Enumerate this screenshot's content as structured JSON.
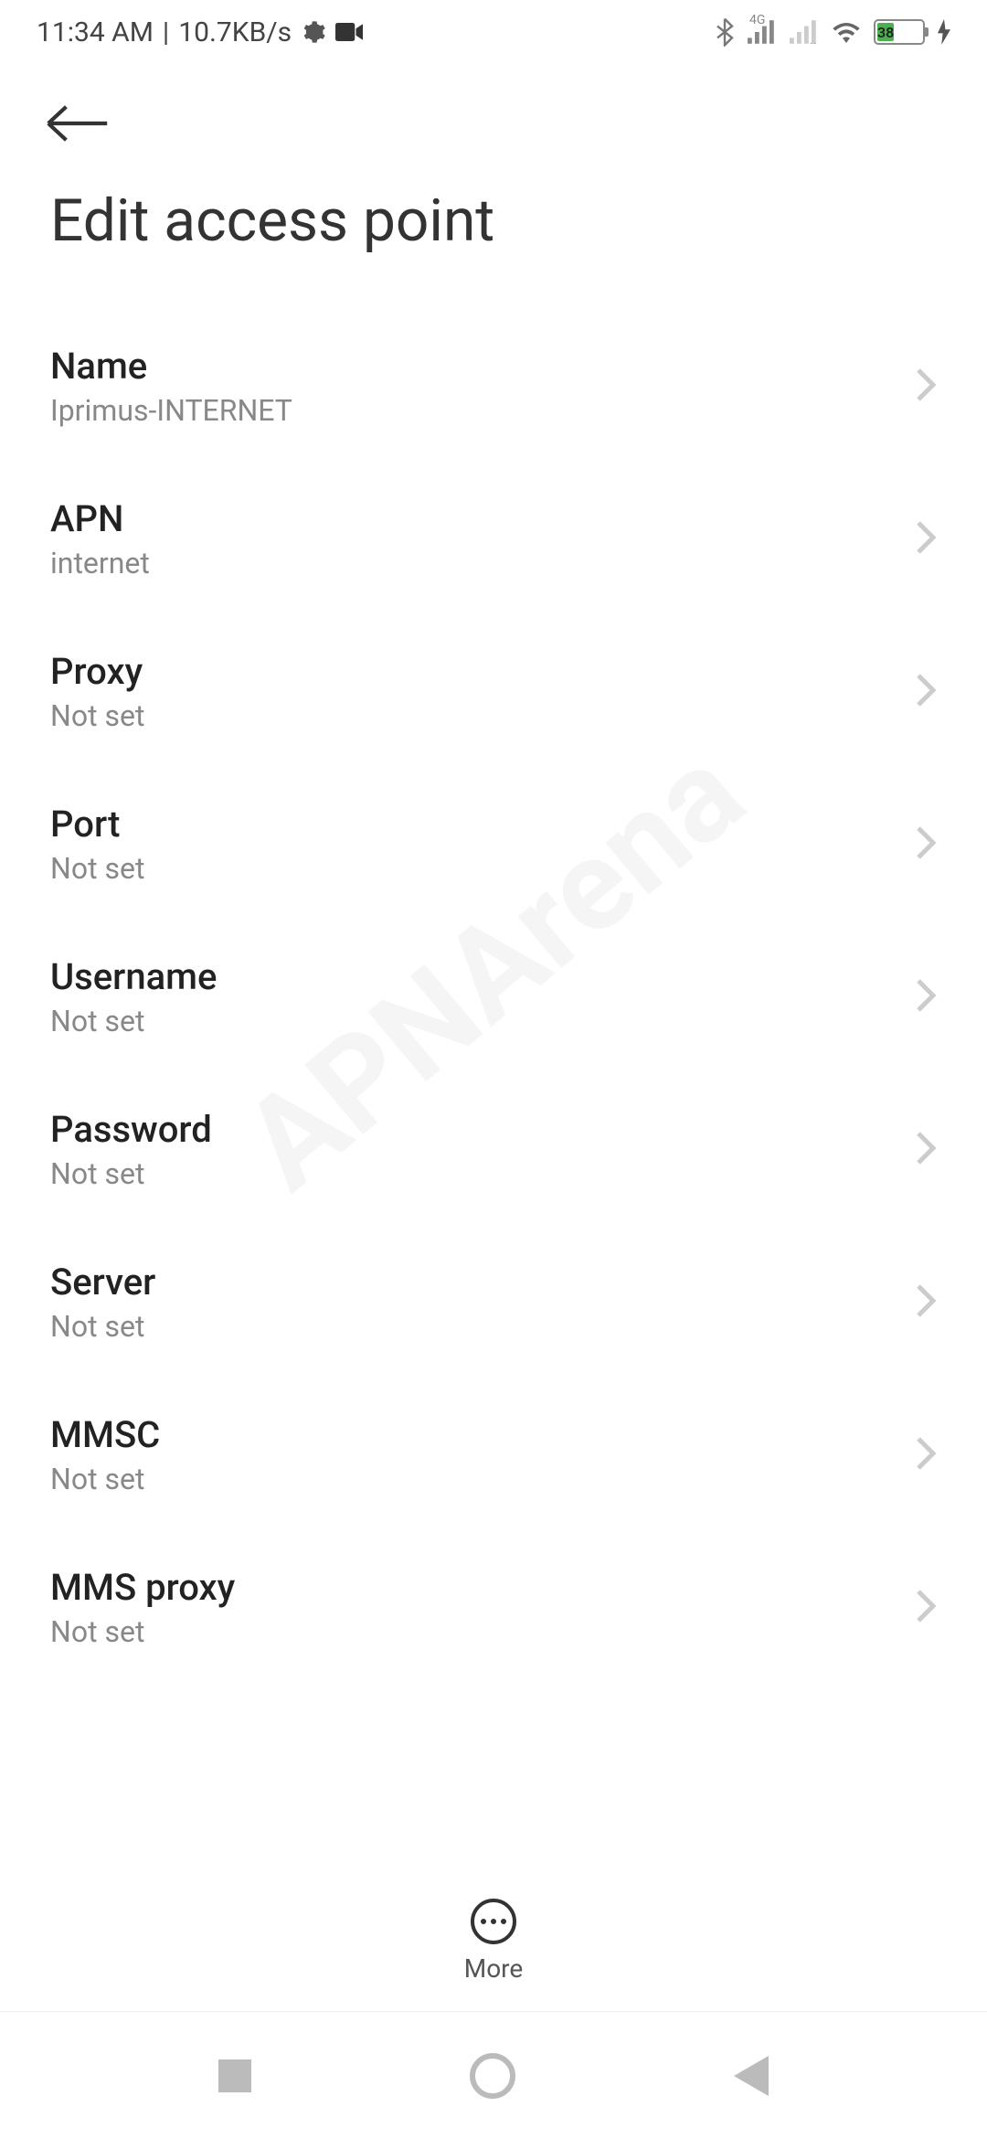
{
  "status": {
    "time": "11:34 AM",
    "speed": "10.7KB/s",
    "battery_percent": "38",
    "network_type": "4G"
  },
  "page": {
    "title": "Edit access point"
  },
  "settings": [
    {
      "label": "Name",
      "value": "Iprimus-INTERNET"
    },
    {
      "label": "APN",
      "value": "internet"
    },
    {
      "label": "Proxy",
      "value": "Not set"
    },
    {
      "label": "Port",
      "value": "Not set"
    },
    {
      "label": "Username",
      "value": "Not set"
    },
    {
      "label": "Password",
      "value": "Not set"
    },
    {
      "label": "Server",
      "value": "Not set"
    },
    {
      "label": "MMSC",
      "value": "Not set"
    },
    {
      "label": "MMS proxy",
      "value": "Not set"
    }
  ],
  "bottom_action": {
    "label": "More"
  },
  "watermark": "APNArena"
}
